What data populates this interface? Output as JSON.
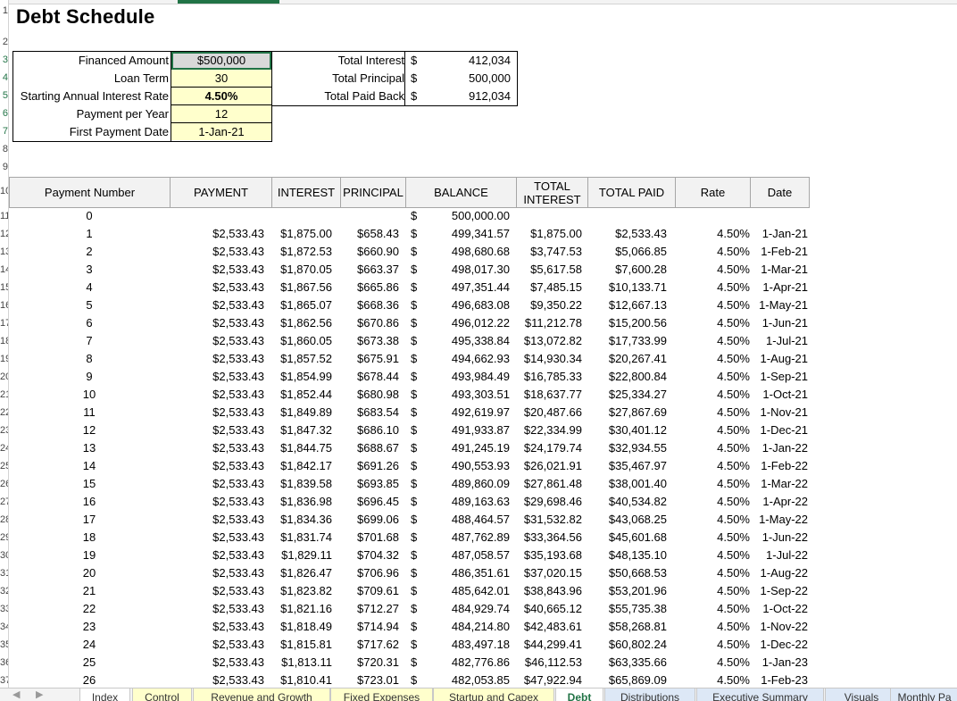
{
  "sheet": {
    "title": "Debt Schedule",
    "row_numbers": [
      "1",
      "2",
      "3",
      "4",
      "5",
      "6",
      "7",
      "8",
      "9",
      "10",
      "11",
      "12",
      "13",
      "14",
      "15",
      "16",
      "17",
      "18",
      "19",
      "20",
      "21",
      "22",
      "23",
      "24",
      "25",
      "26",
      "27",
      "28",
      "29",
      "30",
      "31",
      "32",
      "33",
      "34",
      "35",
      "36",
      "37"
    ]
  },
  "inputs": [
    {
      "label": "Financed Amount",
      "value": "$500,000"
    },
    {
      "label": "Loan Term",
      "value": "30"
    },
    {
      "label": "Starting Annual Interest Rate",
      "value": "4.50%"
    },
    {
      "label": "Payment per Year",
      "value": "12"
    },
    {
      "label": "First Payment Date",
      "value": "1-Jan-21"
    }
  ],
  "totals": [
    {
      "label": "Total Interest",
      "symbol": "$",
      "value": "412,034"
    },
    {
      "label": "Total Principal",
      "symbol": "$",
      "value": "500,000"
    },
    {
      "label": "Total Paid Back",
      "symbol": "$",
      "value": "912,034"
    }
  ],
  "table": {
    "headers": [
      "Payment Number",
      "PAYMENT",
      "INTEREST",
      "PRINCIPAL",
      "BALANCE",
      "TOTAL INTEREST",
      "TOTAL PAID",
      "Rate",
      "Date"
    ],
    "currency_symbol": "$",
    "rows": [
      [
        "0",
        "",
        "",
        "",
        "500,000.00",
        "",
        "",
        "",
        ""
      ],
      [
        "1",
        "$2,533.43",
        "$1,875.00",
        "$658.43",
        "499,341.57",
        "$1,875.00",
        "$2,533.43",
        "4.50%",
        "1-Jan-21"
      ],
      [
        "2",
        "$2,533.43",
        "$1,872.53",
        "$660.90",
        "498,680.68",
        "$3,747.53",
        "$5,066.85",
        "4.50%",
        "1-Feb-21"
      ],
      [
        "3",
        "$2,533.43",
        "$1,870.05",
        "$663.37",
        "498,017.30",
        "$5,617.58",
        "$7,600.28",
        "4.50%",
        "1-Mar-21"
      ],
      [
        "4",
        "$2,533.43",
        "$1,867.56",
        "$665.86",
        "497,351.44",
        "$7,485.15",
        "$10,133.71",
        "4.50%",
        "1-Apr-21"
      ],
      [
        "5",
        "$2,533.43",
        "$1,865.07",
        "$668.36",
        "496,683.08",
        "$9,350.22",
        "$12,667.13",
        "4.50%",
        "1-May-21"
      ],
      [
        "6",
        "$2,533.43",
        "$1,862.56",
        "$670.86",
        "496,012.22",
        "$11,212.78",
        "$15,200.56",
        "4.50%",
        "1-Jun-21"
      ],
      [
        "7",
        "$2,533.43",
        "$1,860.05",
        "$673.38",
        "495,338.84",
        "$13,072.82",
        "$17,733.99",
        "4.50%",
        "1-Jul-21"
      ],
      [
        "8",
        "$2,533.43",
        "$1,857.52",
        "$675.91",
        "494,662.93",
        "$14,930.34",
        "$20,267.41",
        "4.50%",
        "1-Aug-21"
      ],
      [
        "9",
        "$2,533.43",
        "$1,854.99",
        "$678.44",
        "493,984.49",
        "$16,785.33",
        "$22,800.84",
        "4.50%",
        "1-Sep-21"
      ],
      [
        "10",
        "$2,533.43",
        "$1,852.44",
        "$680.98",
        "493,303.51",
        "$18,637.77",
        "$25,334.27",
        "4.50%",
        "1-Oct-21"
      ],
      [
        "11",
        "$2,533.43",
        "$1,849.89",
        "$683.54",
        "492,619.97",
        "$20,487.66",
        "$27,867.69",
        "4.50%",
        "1-Nov-21"
      ],
      [
        "12",
        "$2,533.43",
        "$1,847.32",
        "$686.10",
        "491,933.87",
        "$22,334.99",
        "$30,401.12",
        "4.50%",
        "1-Dec-21"
      ],
      [
        "13",
        "$2,533.43",
        "$1,844.75",
        "$688.67",
        "491,245.19",
        "$24,179.74",
        "$32,934.55",
        "4.50%",
        "1-Jan-22"
      ],
      [
        "14",
        "$2,533.43",
        "$1,842.17",
        "$691.26",
        "490,553.93",
        "$26,021.91",
        "$35,467.97",
        "4.50%",
        "1-Feb-22"
      ],
      [
        "15",
        "$2,533.43",
        "$1,839.58",
        "$693.85",
        "489,860.09",
        "$27,861.48",
        "$38,001.40",
        "4.50%",
        "1-Mar-22"
      ],
      [
        "16",
        "$2,533.43",
        "$1,836.98",
        "$696.45",
        "489,163.63",
        "$29,698.46",
        "$40,534.82",
        "4.50%",
        "1-Apr-22"
      ],
      [
        "17",
        "$2,533.43",
        "$1,834.36",
        "$699.06",
        "488,464.57",
        "$31,532.82",
        "$43,068.25",
        "4.50%",
        "1-May-22"
      ],
      [
        "18",
        "$2,533.43",
        "$1,831.74",
        "$701.68",
        "487,762.89",
        "$33,364.56",
        "$45,601.68",
        "4.50%",
        "1-Jun-22"
      ],
      [
        "19",
        "$2,533.43",
        "$1,829.11",
        "$704.32",
        "487,058.57",
        "$35,193.68",
        "$48,135.10",
        "4.50%",
        "1-Jul-22"
      ],
      [
        "20",
        "$2,533.43",
        "$1,826.47",
        "$706.96",
        "486,351.61",
        "$37,020.15",
        "$50,668.53",
        "4.50%",
        "1-Aug-22"
      ],
      [
        "21",
        "$2,533.43",
        "$1,823.82",
        "$709.61",
        "485,642.01",
        "$38,843.96",
        "$53,201.96",
        "4.50%",
        "1-Sep-22"
      ],
      [
        "22",
        "$2,533.43",
        "$1,821.16",
        "$712.27",
        "484,929.74",
        "$40,665.12",
        "$55,735.38",
        "4.50%",
        "1-Oct-22"
      ],
      [
        "23",
        "$2,533.43",
        "$1,818.49",
        "$714.94",
        "484,214.80",
        "$42,483.61",
        "$58,268.81",
        "4.50%",
        "1-Nov-22"
      ],
      [
        "24",
        "$2,533.43",
        "$1,815.81",
        "$717.62",
        "483,497.18",
        "$44,299.41",
        "$60,802.24",
        "4.50%",
        "1-Dec-22"
      ],
      [
        "25",
        "$2,533.43",
        "$1,813.11",
        "$720.31",
        "482,776.86",
        "$46,112.53",
        "$63,335.66",
        "4.50%",
        "1-Jan-23"
      ],
      [
        "26",
        "$2,533.43",
        "$1,810.41",
        "$723.01",
        "482,053.85",
        "$47,922.94",
        "$65,869.09",
        "4.50%",
        "1-Feb-23"
      ]
    ]
  },
  "sheet_tabs": [
    {
      "label": "Index",
      "style": "plain"
    },
    {
      "label": "Control",
      "style": "yellow"
    },
    {
      "label": "Revenue and Growth",
      "style": "yellow"
    },
    {
      "label": "Fixed Expenses",
      "style": "yellow"
    },
    {
      "label": "Startup and Capex",
      "style": "yellow"
    },
    {
      "label": "Debt",
      "style": "active"
    },
    {
      "label": "Distributions",
      "style": "blue"
    },
    {
      "label": "Executive Summary",
      "style": "blue"
    },
    {
      "label": "Visuals",
      "style": "blue"
    },
    {
      "label": "Monthly Pa",
      "style": "blue"
    }
  ],
  "colors": {
    "input_fill": "#ffffcc",
    "selected_cell_fill": "#d9d9d9",
    "header_fill": "#f2f2f2",
    "active_tab_text": "#217346"
  }
}
